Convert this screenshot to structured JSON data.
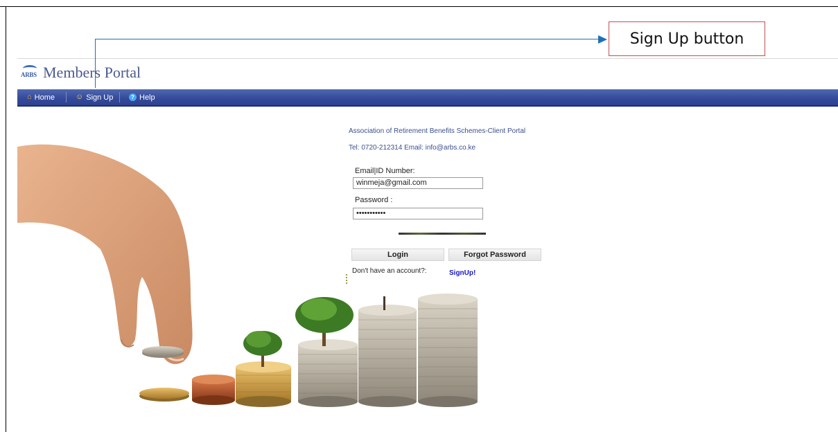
{
  "annotation": {
    "label": "Sign Up button"
  },
  "logo": {
    "abbr": "ARBS",
    "title": "Members Portal"
  },
  "nav": [
    {
      "label": "Home",
      "icon": "home-icon"
    },
    {
      "label": "Sign Up",
      "icon": "user-key-icon"
    },
    {
      "label": "Help",
      "icon": "help-icon"
    }
  ],
  "login": {
    "association": "Association of Retirement Benefits Schemes-Client Portal",
    "contact": "Tel: 0720-212314 Email: info@arbs.co.ke",
    "email_label": "Email|ID Number:",
    "email_value": "winmeja@gmail.com",
    "password_label": "Password :",
    "password_value": "•••••••••••",
    "login_button": "Login",
    "forgot_button": "Forgot Password",
    "no_account_text": "Don't have an account?:",
    "signup_link": "SignUp!"
  },
  "colors": {
    "nav_bar": "#34499a",
    "callout_line": "#1f6fb5",
    "callout_border": "#c0504d",
    "link": "#1515c8",
    "portal_text": "#3a4f8f"
  }
}
